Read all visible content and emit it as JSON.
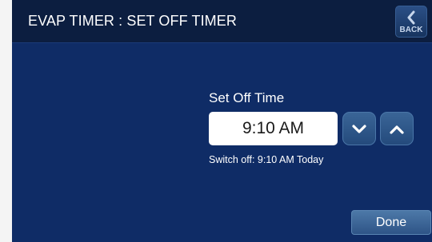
{
  "header": {
    "title": "EVAP TIMER : SET OFF TIMER",
    "back_label": "BACK",
    "back_icon": "chevron-left-icon"
  },
  "timer": {
    "label": "Set Off Time",
    "value": "9:10 AM",
    "down_icon": "chevron-down-icon",
    "up_icon": "chevron-up-icon",
    "info": "Switch off: 9:10 AM Today"
  },
  "footer": {
    "done_label": "Done"
  },
  "colors": {
    "background": "#0f2c66",
    "header": "#0c1e40",
    "button": "#3a6597",
    "time_box": "#ffffff"
  }
}
